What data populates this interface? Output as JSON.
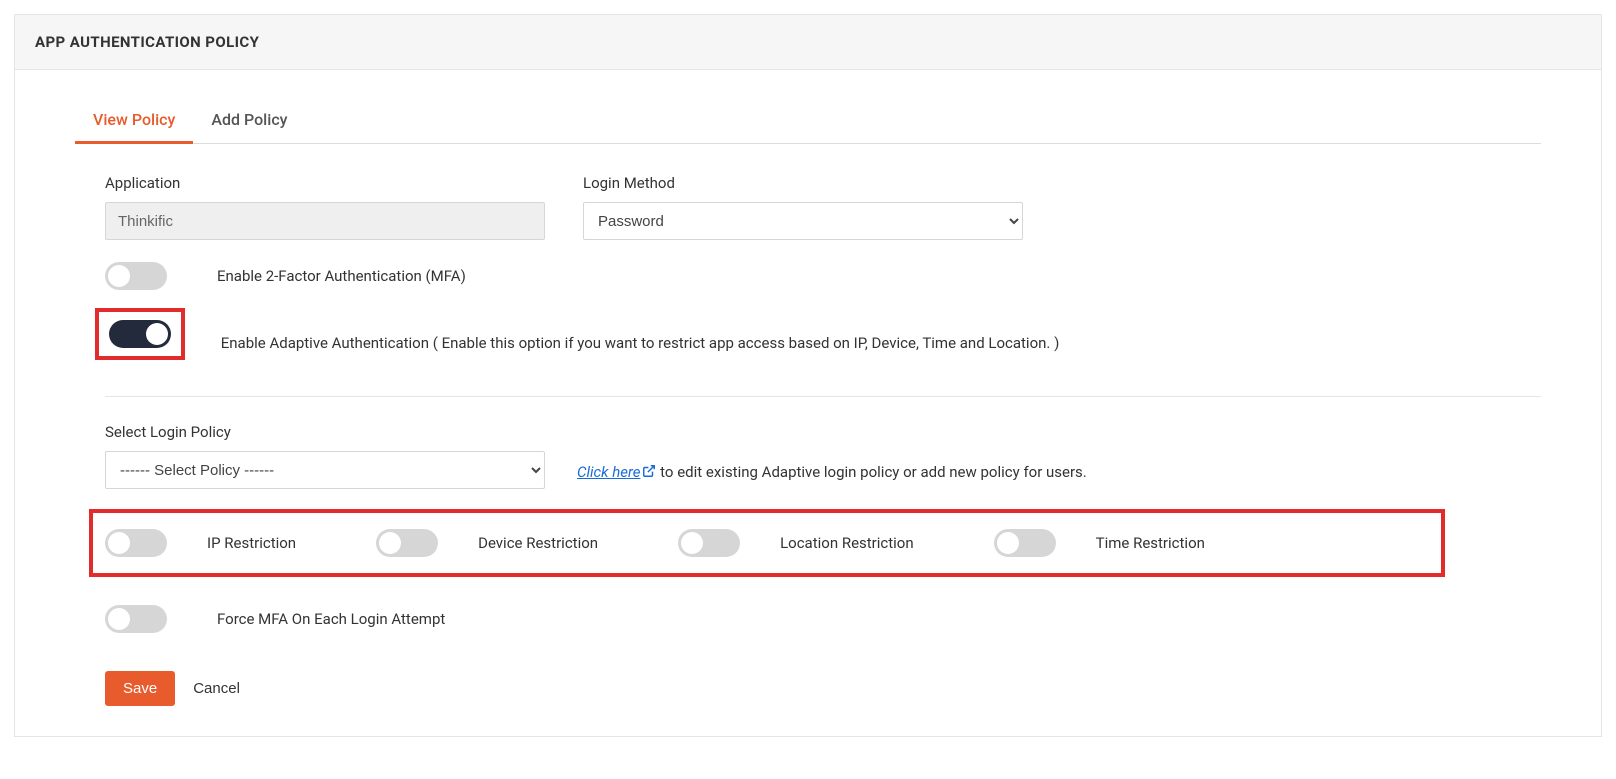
{
  "header": {
    "title": "APP AUTHENTICATION POLICY"
  },
  "tabs": {
    "view": "View Policy",
    "add": "Add Policy"
  },
  "fields": {
    "application_label": "Application",
    "application_value": "Thinkific",
    "login_method_label": "Login Method",
    "login_method_value": "Password"
  },
  "mfa_toggle_label": "Enable 2-Factor Authentication (MFA)",
  "adaptive_toggle_label": "Enable Adaptive Authentication ( Enable this option if you want to restrict app access based on IP, Device, Time and Location. )",
  "policy": {
    "label": "Select Login Policy",
    "placeholder": "------ Select Policy ------",
    "hint_link": "Click here",
    "hint_rest": " to edit existing Adaptive login policy or add new policy for users."
  },
  "restrictions": {
    "ip": "IP Restriction",
    "device": "Device Restriction",
    "location": "Location Restriction",
    "time": "Time Restriction"
  },
  "force_mfa_label": "Force MFA On Each Login Attempt",
  "buttons": {
    "save": "Save",
    "cancel": "Cancel"
  }
}
